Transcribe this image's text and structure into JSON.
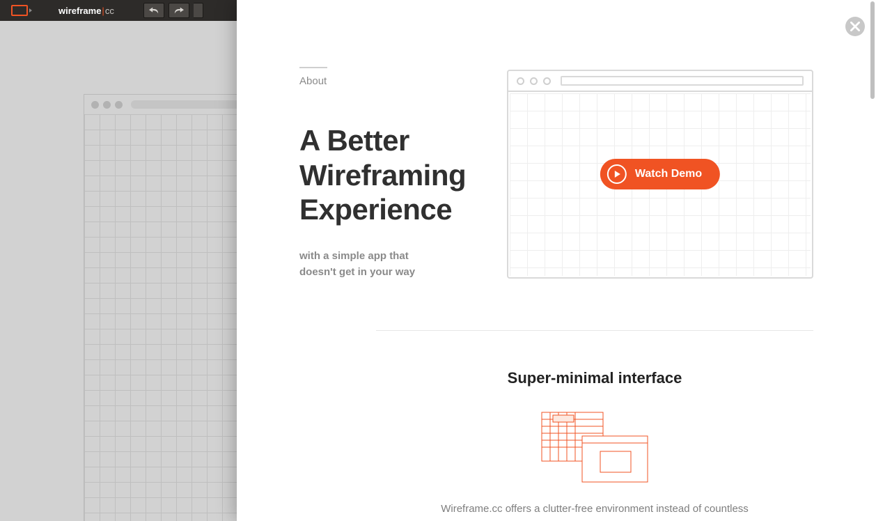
{
  "toolbar": {
    "logo_bold": "wireframe",
    "logo_suffix": "cc"
  },
  "modal": {
    "kicker": "About",
    "headline": "A Better Wireframing Experience",
    "subtext": "with a simple app that doesn't get in your way",
    "demo_label": "Watch Demo",
    "feature_title": "Super-minimal interface",
    "feature_body": "Wireframe.cc offers a clutter-free environment instead of countless"
  },
  "colors": {
    "accent": "#f05323"
  }
}
